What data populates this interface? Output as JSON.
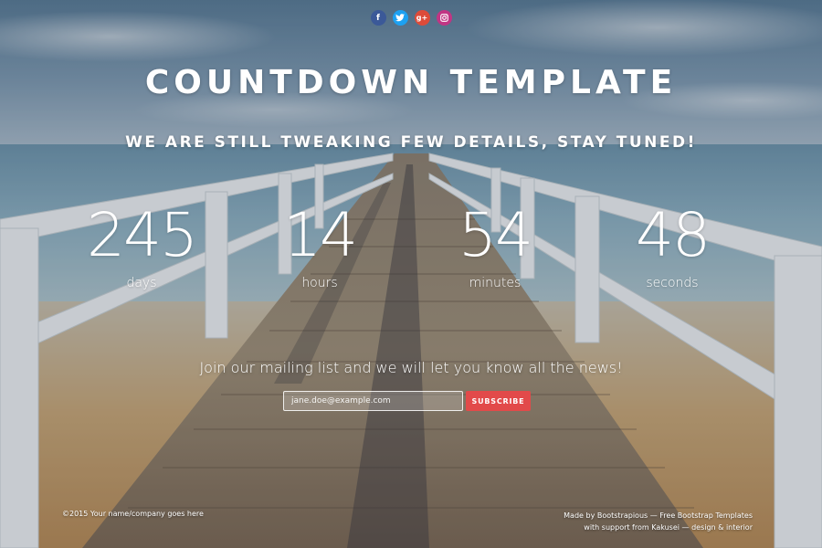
{
  "social": [
    {
      "name": "facebook-icon",
      "glyph": "f",
      "cls": "fb"
    },
    {
      "name": "twitter-icon",
      "glyph": "t",
      "cls": "tw"
    },
    {
      "name": "google-plus-icon",
      "glyph": "g+",
      "cls": "gp"
    },
    {
      "name": "instagram-icon",
      "glyph": "",
      "cls": "ig"
    }
  ],
  "header": {
    "title": "COUNTDOWN TEMPLATE",
    "subtitle": "WE ARE STILL TWEAKING FEW DETAILS, STAY TUNED!"
  },
  "countdown": [
    {
      "value": "245",
      "label": "days"
    },
    {
      "value": "14",
      "label": "hours"
    },
    {
      "value": "54",
      "label": "minutes"
    },
    {
      "value": "48",
      "label": "seconds"
    }
  ],
  "mailing": {
    "text": "Join our mailing list and we will let you know all the news!",
    "placeholder": "jane.doe@example.com",
    "button": "SUBSCRIBE"
  },
  "footer": {
    "copyright": "©2015 Your name/company goes here",
    "credit_line1": "Made by Bootstrapious — Free Bootstrap Templates",
    "credit_line2": "with support from Kakusei — design & interior"
  },
  "colors": {
    "accent": "#e24a4a",
    "facebook": "#3b5998",
    "twitter": "#1da1f2",
    "google_plus": "#dd4b39",
    "instagram": "#c13584"
  }
}
